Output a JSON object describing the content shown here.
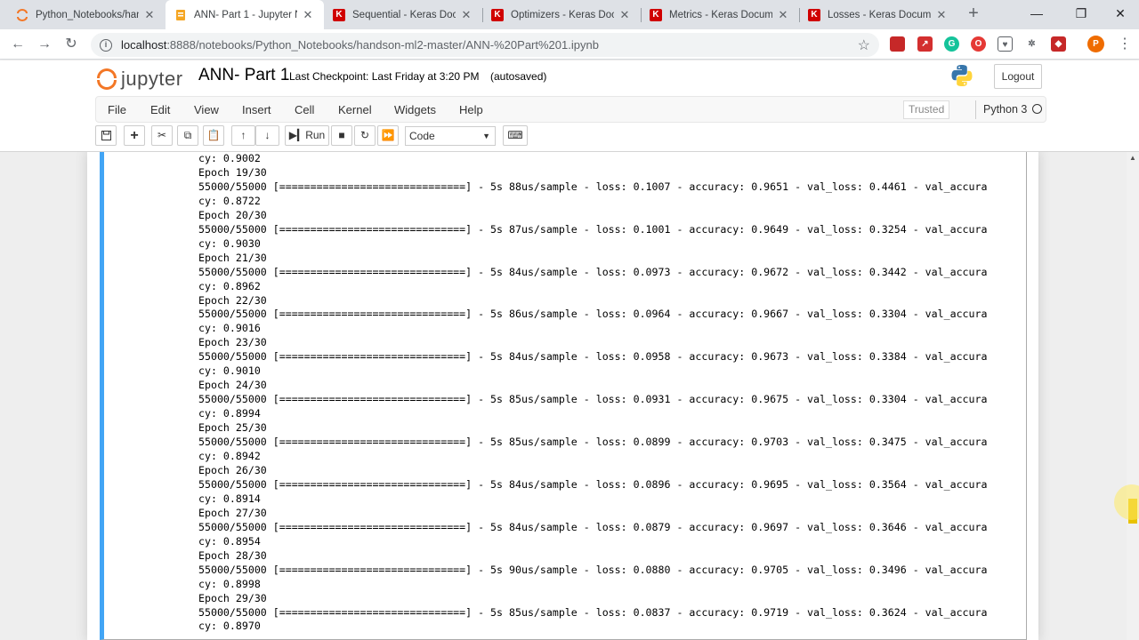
{
  "browser": {
    "tabs": [
      {
        "title": "Python_Notebooks/han",
        "icon": "jupyter-icon",
        "active": false
      },
      {
        "title": "ANN- Part 1 - Jupyter N",
        "icon": "notebook-icon",
        "active": true
      },
      {
        "title": "Sequential - Keras Docu",
        "icon": "keras-icon",
        "active": false
      },
      {
        "title": "Optimizers - Keras Doc",
        "icon": "keras-icon",
        "active": false
      },
      {
        "title": "Metrics - Keras Docume",
        "icon": "keras-icon",
        "active": false
      },
      {
        "title": "Losses - Keras Docume",
        "icon": "keras-icon",
        "active": false
      }
    ],
    "url_host": "localhost",
    "url_rest": ":8888/notebooks/Python_Notebooks/handson-ml2-master/ANN-%20Part%201.ipynb",
    "profile_initial": "P"
  },
  "jupyter": {
    "logo_text": "jupyter",
    "notebook_title": "ANN- Part 1",
    "checkpoint": "Last Checkpoint: Last Friday at 3:20 PM",
    "autosave": "(autosaved)",
    "logout_label": "Logout",
    "menu": [
      "File",
      "Edit",
      "View",
      "Insert",
      "Cell",
      "Kernel",
      "Widgets",
      "Help"
    ],
    "trusted_label": "Trusted",
    "kernel_name": "Python 3",
    "run_label": "Run",
    "cell_type": "Code"
  },
  "output_lines": [
    "cy: 0.9002",
    "Epoch 19/30",
    "55000/55000 [==============================] - 5s 88us/sample - loss: 0.1007 - accuracy: 0.9651 - val_loss: 0.4461 - val_accura",
    "cy: 0.8722",
    "Epoch 20/30",
    "55000/55000 [==============================] - 5s 87us/sample - loss: 0.1001 - accuracy: 0.9649 - val_loss: 0.3254 - val_accura",
    "cy: 0.9030",
    "Epoch 21/30",
    "55000/55000 [==============================] - 5s 84us/sample - loss: 0.0973 - accuracy: 0.9672 - val_loss: 0.3442 - val_accura",
    "cy: 0.8962",
    "Epoch 22/30",
    "55000/55000 [==============================] - 5s 86us/sample - loss: 0.0964 - accuracy: 0.9667 - val_loss: 0.3304 - val_accura",
    "cy: 0.9016",
    "Epoch 23/30",
    "55000/55000 [==============================] - 5s 84us/sample - loss: 0.0958 - accuracy: 0.9673 - val_loss: 0.3384 - val_accura",
    "cy: 0.9010",
    "Epoch 24/30",
    "55000/55000 [==============================] - 5s 85us/sample - loss: 0.0931 - accuracy: 0.9675 - val_loss: 0.3304 - val_accura",
    "cy: 0.8994",
    "Epoch 25/30",
    "55000/55000 [==============================] - 5s 85us/sample - loss: 0.0899 - accuracy: 0.9703 - val_loss: 0.3475 - val_accura",
    "cy: 0.8942",
    "Epoch 26/30",
    "55000/55000 [==============================] - 5s 84us/sample - loss: 0.0896 - accuracy: 0.9695 - val_loss: 0.3564 - val_accura",
    "cy: 0.8914",
    "Epoch 27/30",
    "55000/55000 [==============================] - 5s 84us/sample - loss: 0.0879 - accuracy: 0.9697 - val_loss: 0.3646 - val_accura",
    "cy: 0.8954",
    "Epoch 28/30",
    "55000/55000 [==============================] - 5s 90us/sample - loss: 0.0880 - accuracy: 0.9705 - val_loss: 0.3496 - val_accura",
    "cy: 0.8998",
    "Epoch 29/30",
    "55000/55000 [==============================] - 5s 85us/sample - loss: 0.0837 - accuracy: 0.9719 - val_loss: 0.3624 - val_accura",
    "cy: 0.8970"
  ],
  "colors": {
    "jupyter_orange": "#f37726",
    "cell_selected_border": "#42a5f5",
    "keras_red": "#d00000"
  }
}
